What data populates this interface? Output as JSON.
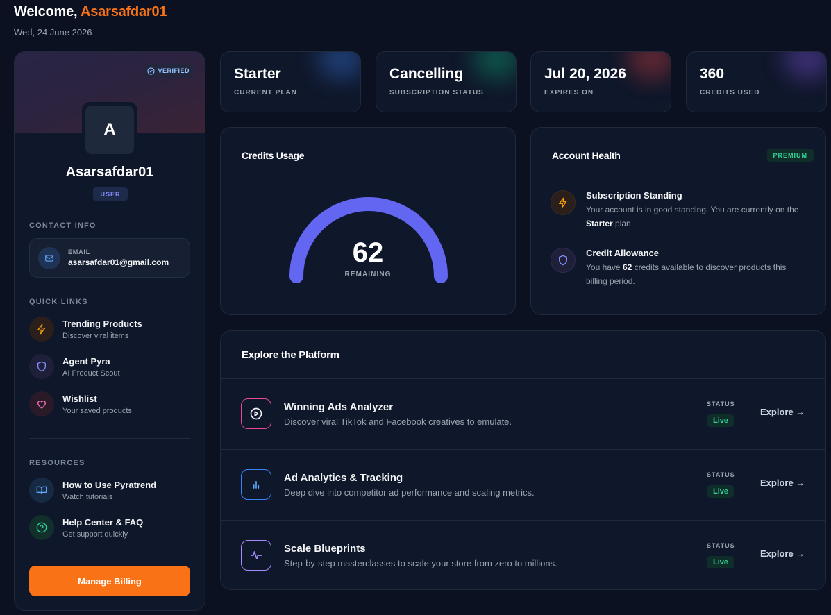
{
  "header": {
    "welcome_prefix": "Welcome, ",
    "username": "Asarsafdar01",
    "date": "Wed, 24 June 2026"
  },
  "profile": {
    "verified_label": "VERIFIED",
    "avatar_initial": "A",
    "name": "Asarsafdar01",
    "role": "USER"
  },
  "contact": {
    "section_label": "CONTACT INFO",
    "email_label": "EMAIL",
    "email_value": "asarsafdar01@gmail.com"
  },
  "quick_links": {
    "section_label": "QUICK LINKS",
    "items": [
      {
        "title": "Trending Products",
        "subtitle": "Discover viral items",
        "icon": "lightning-icon",
        "color": "#f59e0b"
      },
      {
        "title": "Agent Pyra",
        "subtitle": "AI Product Scout",
        "icon": "shield-icon",
        "color": "#818cf8"
      },
      {
        "title": "Wishlist",
        "subtitle": "Your saved products",
        "icon": "heart-icon",
        "color": "#f472b6"
      }
    ]
  },
  "resources": {
    "section_label": "RESOURCES",
    "items": [
      {
        "title": "How to Use Pyratrend",
        "subtitle": "Watch tutorials",
        "icon": "book-icon",
        "color": "#60a5fa"
      },
      {
        "title": "Help Center & FAQ",
        "subtitle": "Get support quickly",
        "icon": "help-circle-icon",
        "color": "#34d399"
      }
    ]
  },
  "billing_button": "Manage Billing",
  "stats": [
    {
      "value": "Starter",
      "label": "CURRENT PLAN",
      "glow": "#3b82f6"
    },
    {
      "value": "Cancelling",
      "label": "SUBSCRIPTION STATUS",
      "glow": "#10b981"
    },
    {
      "value": "Jul 20, 2026",
      "label": "EXPIRES ON",
      "glow": "#ef4444"
    },
    {
      "value": "360",
      "label": "CREDITS USED",
      "glow": "#8b5cf6"
    }
  ],
  "credits": {
    "title": "Credits Usage",
    "remaining_value": "62",
    "remaining_label": "REMAINING",
    "gauge_color": "#6366f1"
  },
  "health": {
    "title": "Account Health",
    "badge": "PREMIUM",
    "items": [
      {
        "title": "Subscription Standing",
        "text_before": "Your account is in good standing. You are currently on the ",
        "text_bold": "Starter",
        "text_after": " plan.",
        "icon": "lightning-icon"
      },
      {
        "title": "Credit Allowance",
        "text_before": "You have ",
        "text_bold": "62",
        "text_after": " credits available to discover products this billing period.",
        "icon": "shield-icon"
      }
    ]
  },
  "explore": {
    "title": "Explore the Platform",
    "status_label": "STATUS",
    "live_label": "Live",
    "link_label": "Explore →",
    "rows": [
      {
        "title": "Winning Ads Analyzer",
        "desc": "Discover viral TikTok and Facebook creatives to emulate.",
        "icon": "play-circle-icon"
      },
      {
        "title": "Ad Analytics & Tracking",
        "desc": "Deep dive into competitor ad performance and scaling metrics.",
        "icon": "bar-chart-icon"
      },
      {
        "title": "Scale Blueprints",
        "desc": "Step-by-step masterclasses to scale your store from zero to millions.",
        "icon": "activity-icon"
      }
    ]
  }
}
